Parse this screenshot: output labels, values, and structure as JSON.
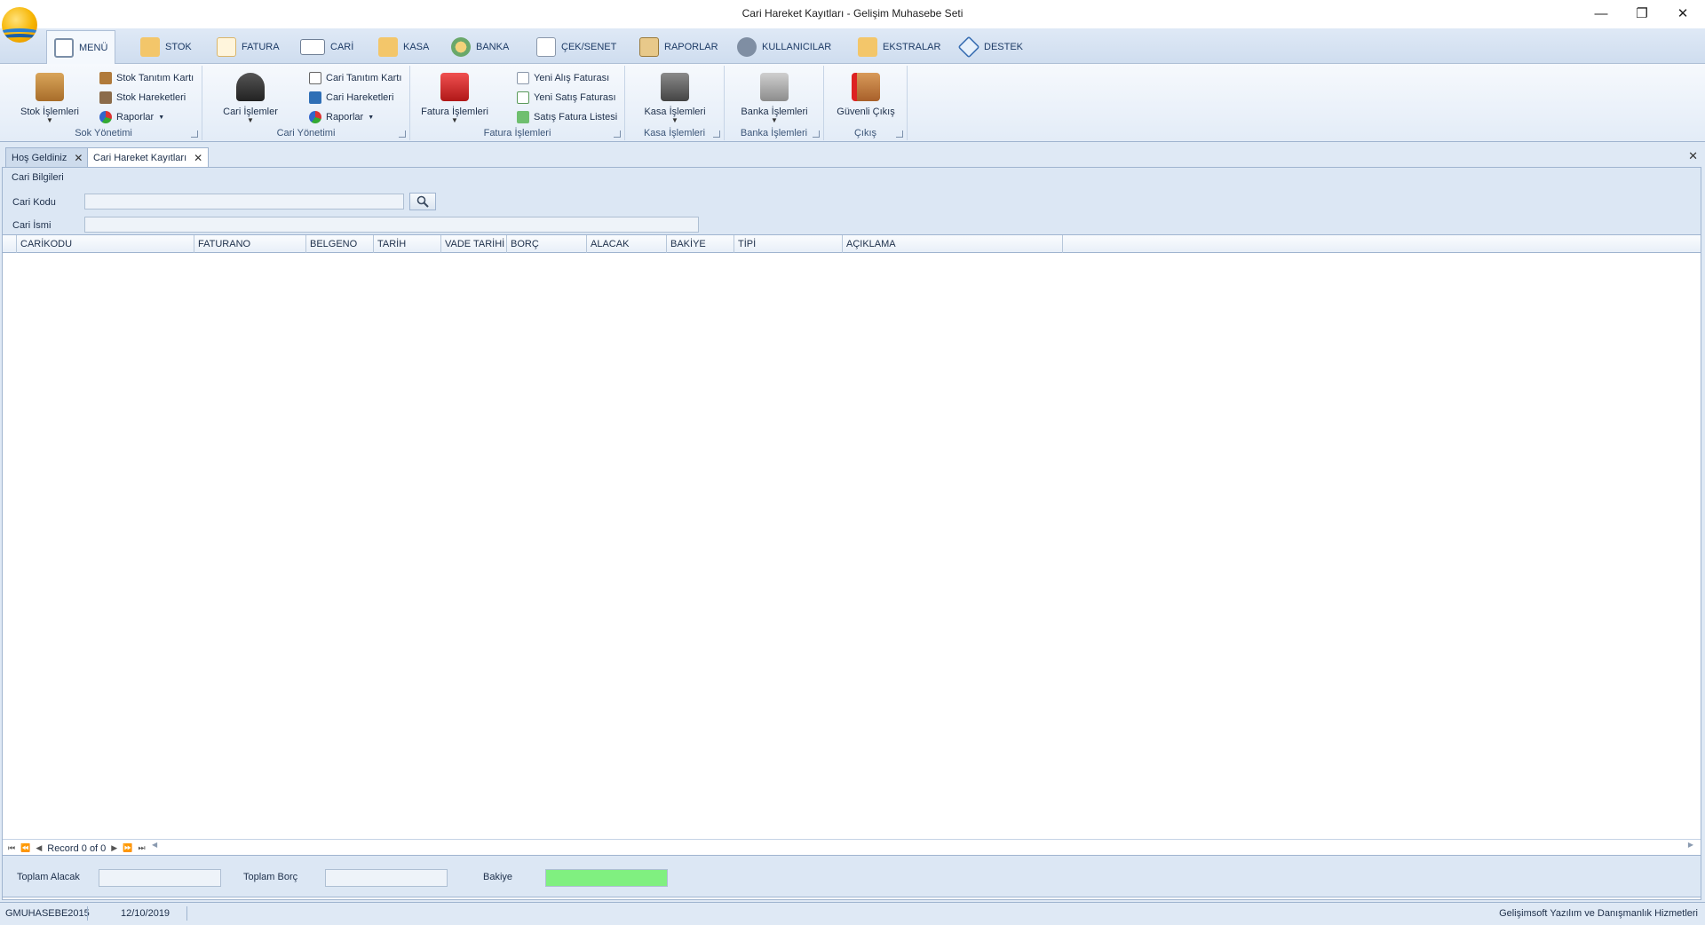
{
  "window": {
    "title": "Cari Hareket Kayıtları - Gelişim Muhasebe Seti",
    "minimize_icon": "minimize-icon",
    "maximize_icon": "restore-icon",
    "close_icon": "close-icon"
  },
  "ribbon_tabs": [
    {
      "label": "MENÜ",
      "icon": "home-icon",
      "active": true
    },
    {
      "label": "STOK",
      "icon": "box-icon"
    },
    {
      "label": "FATURA",
      "icon": "document-icon"
    },
    {
      "label": "CARİ",
      "icon": "id-card-icon"
    },
    {
      "label": "KASA",
      "icon": "cash-icon"
    },
    {
      "label": "BANKA",
      "icon": "coins-icon"
    },
    {
      "label": "ÇEK/SENET",
      "icon": "cheque-icon"
    },
    {
      "label": "RAPORLAR",
      "icon": "clipboard-icon"
    },
    {
      "label": "KULLANICILAR",
      "icon": "users-gear-icon"
    },
    {
      "label": "EKSTRALAR",
      "icon": "extras-gear-icon"
    },
    {
      "label": "DESTEK",
      "icon": "tag-icon"
    }
  ],
  "ribbon": {
    "stok_group": {
      "big": "Stok İşlemleri",
      "items": [
        "Stok Tanıtım Kartı",
        "Stok Hareketleri",
        "Raporlar"
      ],
      "label": "Sok Yönetimi"
    },
    "cari_group": {
      "big": "Cari İşlemler",
      "items": [
        "Cari Tanıtım Kartı",
        "Cari Hareketleri",
        "Raporlar"
      ],
      "label": "Cari Yönetimi"
    },
    "fatura_group": {
      "big": "Fatura İşlemleri",
      "items": [
        "Yeni Alış Faturası",
        "Yeni Satış Faturası",
        "Satış Fatura Listesi"
      ],
      "label": "Fatura İşlemleri"
    },
    "kasa_group": {
      "big": "Kasa İşlemleri",
      "label": "Kasa İşlemleri"
    },
    "banka_group": {
      "big": "Banka İşlemleri",
      "label": "Banka İşlemleri"
    },
    "cikis_group": {
      "big": "Güvenli Çıkış",
      "label": "Çıkış"
    }
  },
  "doc_tabs": [
    {
      "label": "Hoş Geldiniz",
      "active": false
    },
    {
      "label": "Cari Hareket Kayıtları",
      "active": true
    }
  ],
  "cari_bilgileri": {
    "title": "Cari Bilgileri",
    "kod_label": "Cari Kodu",
    "kod_value": "",
    "isim_label": "Cari İsmi",
    "isim_value": ""
  },
  "grid": {
    "columns": [
      "CARİKODU",
      "FATURANO",
      "BELGENO",
      "TARİH",
      "VADE TARİHİ",
      "BORÇ",
      "ALACAK",
      "BAKİYE",
      "TİPİ",
      "AÇIKLAMA"
    ],
    "rows": [],
    "record_text": "Record 0 of 0"
  },
  "totals": {
    "alacak_label": "Toplam Alacak",
    "alacak_value": "",
    "borc_label": "Toplam Borç",
    "borc_value": "",
    "bakiye_label": "Bakiye",
    "bakiye_value": "",
    "bakiye_color": "#80f080"
  },
  "status": {
    "db": "GMUHASEBE2015",
    "date": "12/10/2019",
    "company": "Gelişimsoft Yazılım ve Danışmanlık Hizmetleri"
  },
  "colors": {
    "ribbon_bg": "#e3ecf7",
    "panel_bg": "#dce7f4",
    "accent": "#1d3b66"
  }
}
